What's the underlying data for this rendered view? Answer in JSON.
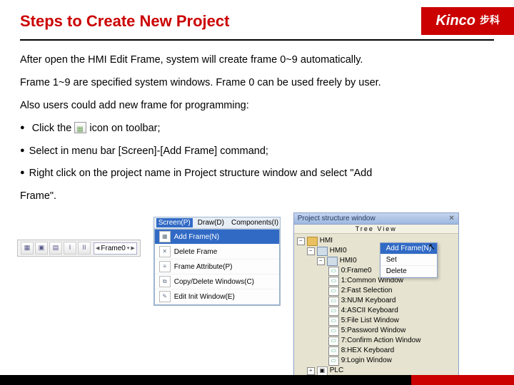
{
  "header": {
    "title": "Steps to Create New Project",
    "brand": "Kinco",
    "brand_cn": "步科"
  },
  "content": {
    "p1": "After open the HMI Edit Frame, system will create frame 0~9 automatically.",
    "p2": "Frame 1~9 are specified system windows. Frame 0 can be used freely by user.",
    "p3": "Also users could add new frame for programming:",
    "li1a": "Click the ",
    "li1b": " icon on toolbar;",
    "li2": "Select in menu bar [Screen]-[Add Frame] command;",
    "li3": "Right click on the project name in Project structure window and select \"Add",
    "li3b": "Frame\"."
  },
  "toolbar": {
    "frame_label": "Frame0"
  },
  "menu": {
    "bar": {
      "screen": "Screen(P)",
      "draw": "Draw(D)",
      "components": "Components(I)"
    },
    "items": {
      "add": "Add Frame(N)",
      "delete": "Delete Frame",
      "attr": "Frame Attribute(P)",
      "copy": "Copy/Delete Windows(C)",
      "edit": "Edit Init Window(E)"
    }
  },
  "tree": {
    "title": "Project structure window",
    "view": "Tree View",
    "root": "HMI",
    "hmi0": "HMI0",
    "nodes": {
      "n0": "0:Frame0",
      "n1": "1:Common Window",
      "n2": "2:Fast Selection",
      "n3": "3:NUM Keyboard",
      "n4": "4:ASCII Keyboard",
      "n5": "5:File List Window",
      "n6": "5:Password Window",
      "n7": "7:Confirm Action Window",
      "n8": "8:HEX Keyboard",
      "n9": "9:Login Window"
    },
    "plc": "PLC",
    "context": {
      "add": "Add Frame(N)",
      "set": "Set",
      "delete": "Delete"
    }
  }
}
